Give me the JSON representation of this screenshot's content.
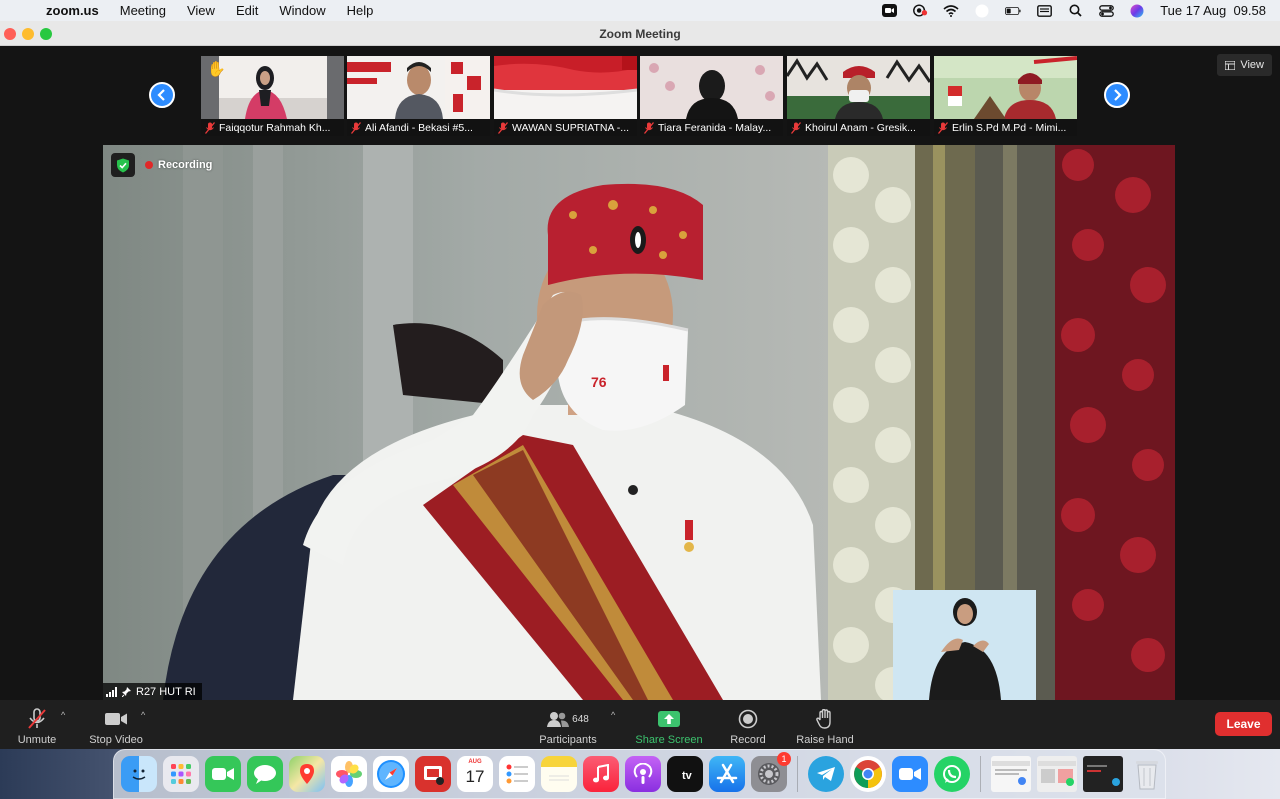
{
  "menubar": {
    "app_name": "zoom.us",
    "items": [
      "Meeting",
      "View",
      "Edit",
      "Window",
      "Help"
    ],
    "clock": "Tue 17 Aug  09.58"
  },
  "window": {
    "title": "Zoom Meeting"
  },
  "view_button": "View",
  "participants_strip": [
    {
      "name": "Faiqqotur Rahmah Kh...",
      "hand_raised": true
    },
    {
      "name": "Ali Afandi - Bekasi #5..."
    },
    {
      "name": "WAWAN SUPRIATNA -..."
    },
    {
      "name": "Tiara Feranida - Malay..."
    },
    {
      "name": "Khoirul Anam - Gresik..."
    },
    {
      "name": "Erlin S.Pd M.Pd - Mimi..."
    }
  ],
  "main_video": {
    "recording_label": "Recording",
    "speaker_name": "R27 HUT RI"
  },
  "toolbar": {
    "unmute": "Unmute",
    "stop_video": "Stop Video",
    "participants": "Participants",
    "participant_count": "648",
    "share_screen": "Share Screen",
    "record": "Record",
    "raise_hand": "Raise Hand",
    "leave": "Leave"
  },
  "dock": {
    "calendar_month": "AUG",
    "calendar_day": "17",
    "settings_badge": "1"
  },
  "colors": {
    "zoom_blue": "#2d8cff",
    "leave_red": "#e02f2f",
    "share_green": "#3cc36e",
    "recording_red": "#e02828"
  }
}
